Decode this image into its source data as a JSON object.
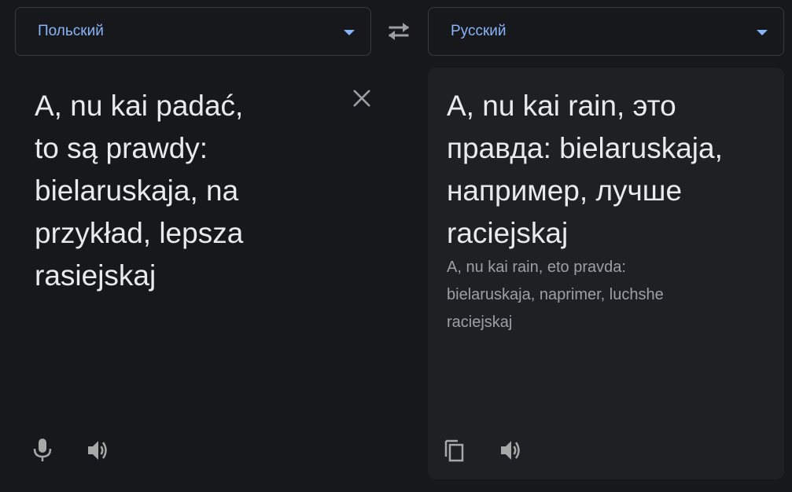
{
  "source_language": {
    "label": "Польский"
  },
  "target_language": {
    "label": "Русский"
  },
  "source_panel": {
    "text": "A, nu kai padać,\nto są prawdy:\nbielaruskaja, na\nprzykład, lepsza\nrasiejskaj",
    "clear_icon": "close-icon",
    "mic_icon": "microphone-icon",
    "listen_icon": "speaker-icon"
  },
  "target_panel": {
    "translation": "A, nu kai rain, это\nправда: bielaruskaja,\nнапример, лучше\nraciejskaj",
    "transliteration": "A, nu kai rain, eto pravda:\nbielaruskaja, naprimer, luchshe\nraciejskaj",
    "copy_icon": "copy-icon",
    "listen_icon": "speaker-icon"
  },
  "swap_icon": "swap-languages-icon",
  "colors": {
    "background": "#17181b",
    "accent": "#8ab4f8",
    "text_primary": "#e8eaed",
    "text_secondary": "#9aa0a6",
    "icon": "#a8a8a8"
  }
}
